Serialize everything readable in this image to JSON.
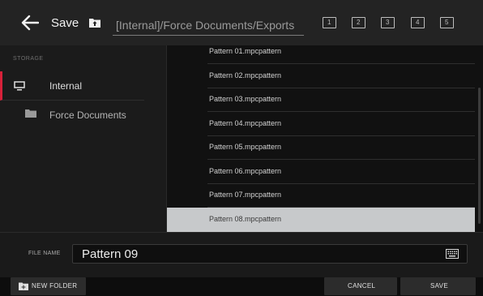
{
  "header": {
    "title": "Save",
    "path": "[Internal]/Force Documents/Exports",
    "slots": [
      "1",
      "2",
      "3",
      "4",
      "5"
    ]
  },
  "sidebar": {
    "section_label": "STORAGE",
    "items": [
      {
        "label": "Internal",
        "icon": "monitor-icon"
      },
      {
        "label": "Force Documents",
        "icon": "folder-icon"
      }
    ]
  },
  "files": {
    "items": [
      "Pattern 01.mpcpattern",
      "Pattern 02.mpcpattern",
      "Pattern 03.mpcpattern",
      "Pattern 04.mpcpattern",
      "Pattern 05.mpcpattern",
      "Pattern 06.mpcpattern",
      "Pattern 07.mpcpattern",
      "Pattern 08.mpcpattern"
    ],
    "selected": "Pattern 08.mpcpattern"
  },
  "filename": {
    "label": "FILE NAME",
    "value": "Pattern 09"
  },
  "footer": {
    "new_folder": "NEW FOLDER",
    "cancel": "CANCEL",
    "save": "SAVE"
  },
  "colors": {
    "accent": "#d7213a",
    "selected_row": "#c7c9cb"
  }
}
